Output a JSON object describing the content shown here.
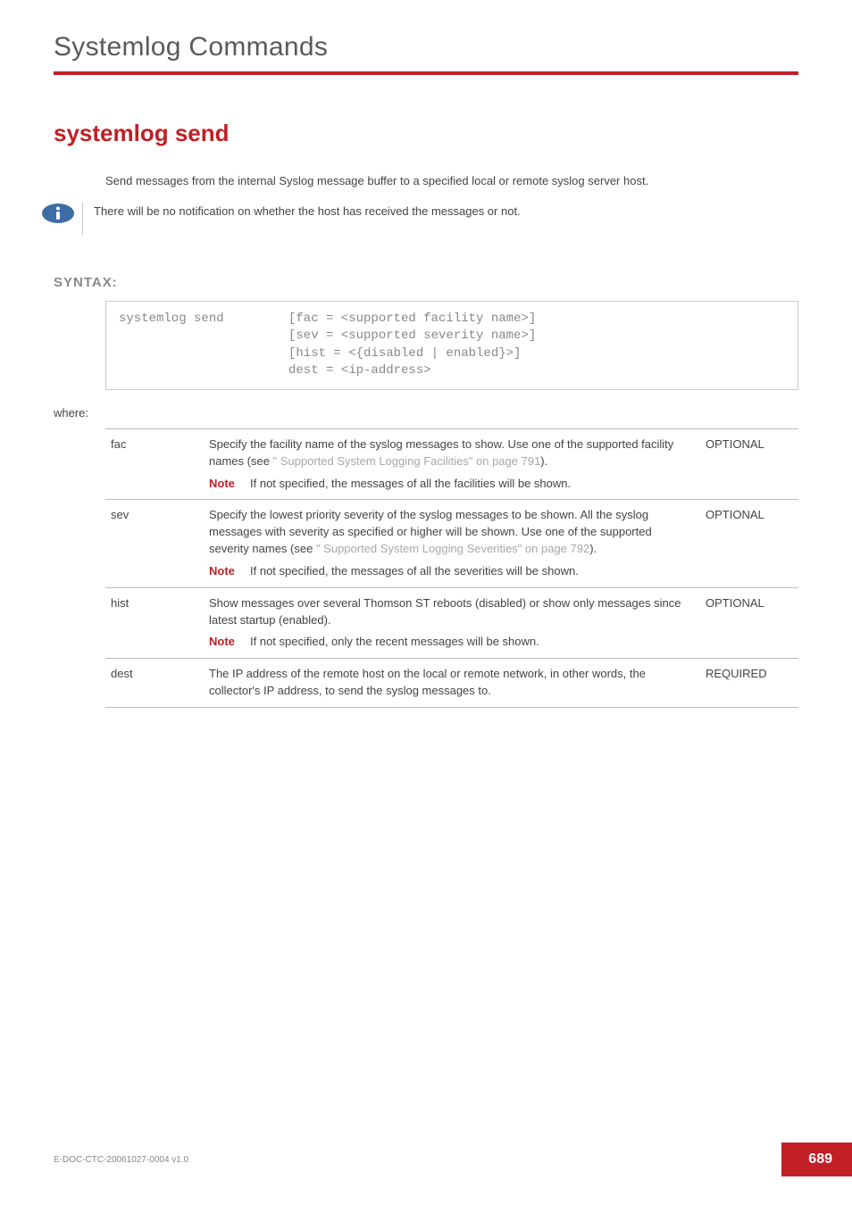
{
  "header": {
    "title": "Systemlog Commands"
  },
  "section": {
    "title": "systemlog send"
  },
  "intro": "Send messages from the internal Syslog message buffer to a specified local or remote syslog server host.",
  "top_note": "There will be no notification on whether the host has received the messages or not.",
  "syntax": {
    "label": "SYNTAX:",
    "cmd": "systemlog send",
    "args_l1": "[fac = <supported facility name>]",
    "args_l2": "[sev = <supported severity name>]",
    "args_l3": "[hist = <{disabled | enabled}>]",
    "args_l4": "dest = <ip-address>"
  },
  "where_label": "where:",
  "note_word": "Note",
  "params": [
    {
      "name": "fac",
      "desc_pre": "Specify the facility name of the syslog messages to show.\nUse one of the supported facility names (see ",
      "desc_link": "\" Supported System Logging Facilities\" on page 791",
      "desc_post": ").",
      "note": "If not specified, the messages of all the facilities will be shown.",
      "req": "OPTIONAL"
    },
    {
      "name": "sev",
      "desc_pre": "Specify the lowest priority severity of the syslog messages to be shown.\nAll the syslog messages with severity as specified or higher will be shown.\nUse one of the supported severity names (see ",
      "desc_link": "\" Supported System Logging Severities\" on page 792",
      "desc_post": ").",
      "note": "If not specified, the messages of all the severities will be shown.",
      "req": "OPTIONAL"
    },
    {
      "name": "hist",
      "desc_pre": "Show messages over several Thomson ST reboots (disabled) or show only messages since latest startup (enabled).",
      "desc_link": "",
      "desc_post": "",
      "note": "If not specified, only the recent messages will be shown.",
      "req": "OPTIONAL"
    },
    {
      "name": "dest",
      "desc_pre": "The IP address of the remote host on the local or remote network, in other words, the collector's IP address, to send the syslog messages to.",
      "desc_link": "",
      "desc_post": "",
      "note": "",
      "req": "REQUIRED"
    }
  ],
  "footer": {
    "doc_id": "E-DOC-CTC-20061027-0004 v1.0",
    "page": "689"
  }
}
